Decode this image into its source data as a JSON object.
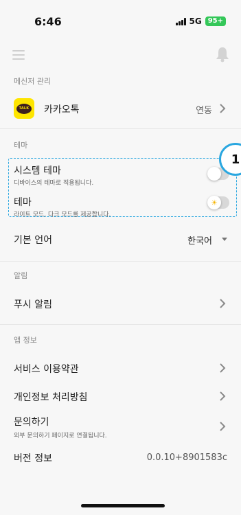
{
  "status_bar": {
    "time": "6:46",
    "network": "5G",
    "battery": "95+"
  },
  "header": {
    "menu_icon": "hamburger-icon",
    "bell_icon": "bell-icon"
  },
  "messenger": {
    "section_label": "메신저 관리",
    "kakao_label": "카카오톡",
    "kakao_icon_text": "TALK",
    "kakao_status": "연동"
  },
  "theme": {
    "section_label": "테마",
    "system_theme_label": "시스템 테마",
    "system_theme_sub": "디바이스의 테마로 적용됩니다.",
    "system_theme_on": false,
    "theme_label": "테마",
    "theme_sub": "라이트 모드, 다크 모드를 제공합니다.",
    "theme_dark": false,
    "theme_icon": "sun-icon"
  },
  "language": {
    "label": "기본 언어",
    "value": "한국어"
  },
  "alerts": {
    "section_label": "알림",
    "push_label": "푸시 알림"
  },
  "app_info": {
    "section_label": "앱 정보",
    "terms_label": "서비스 이용약관",
    "privacy_label": "개인정보 처리방침",
    "inquiry_label": "문의하기",
    "inquiry_sub": "외부 문의하기 페이지로 연결됩니다.",
    "version_label": "버전 정보",
    "version_value": "0.0.10+8901583c"
  },
  "annotation": {
    "badge": "1"
  },
  "colors": {
    "accent": "#2aa7e0",
    "kakao": "#fee500",
    "battery": "#34c759"
  }
}
